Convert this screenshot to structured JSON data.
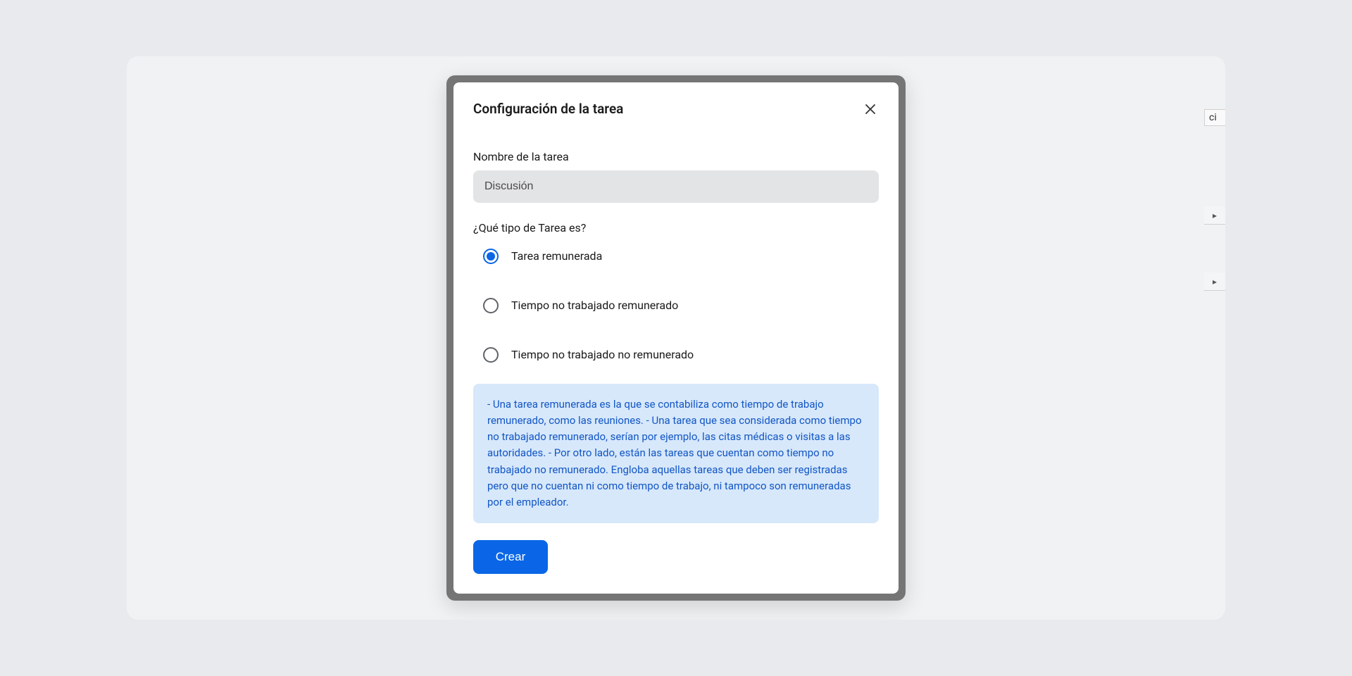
{
  "modal": {
    "title": "Configuración de la tarea",
    "fields": {
      "task_name_label": "Nombre de la tarea",
      "task_name_value": "Discusión",
      "task_type_label": "¿Qué tipo de Tarea es?"
    },
    "radio_options": [
      {
        "label": "Tarea remunerada",
        "selected": true
      },
      {
        "label": "Tiempo no trabajado remunerado",
        "selected": false
      },
      {
        "label": "Tiempo no trabajado no remunerado",
        "selected": false
      }
    ],
    "info_text": " - Una tarea remunerada es la que se contabiliza como tiempo de trabajo remunerado, como las reuniones. - Una tarea que sea considerada como tiempo no trabajado remunerado, serían por ejemplo, las citas médicas o visitas a las autoridades. - Por otro lado, están las tareas que cuentan como tiempo no trabajado no remunerado. Engloba aquellas tareas que deben ser registradas pero que no cuentan ni como tiempo de trabajo, ni tampoco son remuneradas por el empleador.",
    "create_button": "Crear"
  },
  "background": {
    "hint_text": "ci"
  }
}
